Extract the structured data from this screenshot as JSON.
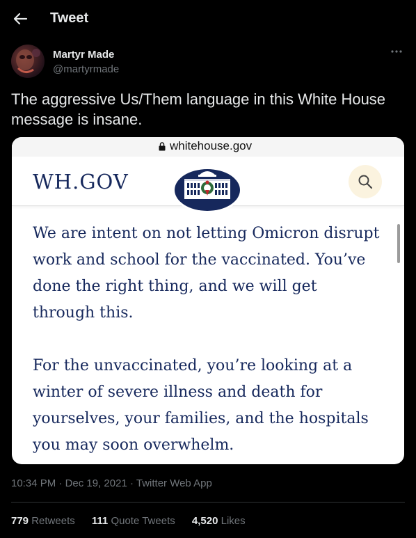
{
  "header": {
    "title": "Tweet"
  },
  "author": {
    "name": "Martyr Made",
    "handle": "@martyrmade"
  },
  "tweet": {
    "text": "The aggressive Us/Them language in this White House message is insane."
  },
  "media": {
    "url": "whitehouse.gov",
    "site_logo": "WH.GOV",
    "paragraphs": [
      "We are intent on not letting Omicron disrupt work and school for the vaccinated.  You’ve done the right thing, and we will get through this.",
      "For the unvaccinated, you’re looking at a winter of severe illness and death for yourselves, your families, and the hospitals you may soon overwhelm."
    ]
  },
  "meta": {
    "time": "10:34 PM",
    "date": "Dec 19, 2021",
    "source": "Twitter Web App"
  },
  "stats": {
    "retweets_count": "779",
    "retweets_label": "Retweets",
    "quotes_count": "111",
    "quotes_label": "Quote Tweets",
    "likes_count": "4,520",
    "likes_label": "Likes"
  },
  "icons": {
    "back": "arrow-left-icon",
    "more": "more-dots-icon",
    "lock": "lock-icon",
    "search": "search-icon"
  },
  "colors": {
    "background": "#000000",
    "text": "#e7e9ea",
    "muted": "#71767b",
    "wh_navy": "#16285c"
  }
}
